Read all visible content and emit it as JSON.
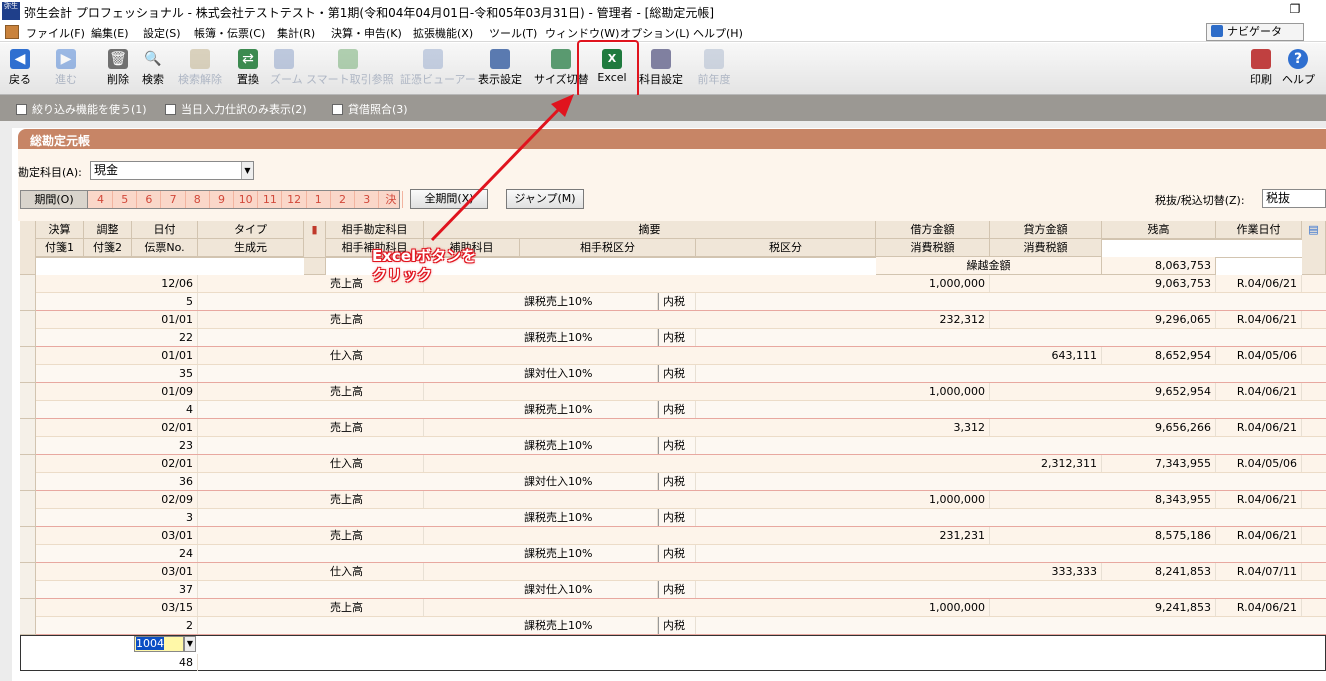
{
  "window": {
    "title": "弥生会計 プロフェッショナル - 株式会社テストテスト・第1期(令和04年04月01日-令和05年03月31日) - 管理者 - [総勘定元帳]",
    "app_icon_text": "弥生",
    "restore_symbol": "❐",
    "close_symbol": "✕"
  },
  "menu": {
    "items": [
      "ファイル(F)",
      "編集(E)",
      "設定(S)",
      "帳簿・伝票(C)",
      "集計(R)",
      "決算・申告(K)",
      "拡張機能(X)",
      "ツール(T)",
      "ウィンドウ(W)",
      "オプション(L)",
      "ヘルプ(H)"
    ],
    "navigator_label": "ナビゲータ"
  },
  "toolbar": {
    "back": "戻る",
    "forward": "進む",
    "delete": "削除",
    "search": "検索",
    "search_clear": "検索解除",
    "replace": "置換",
    "zoom": "ズーム",
    "smart_ref": "スマート取引参照",
    "voucher_viewer": "証憑ビューアー",
    "display_settings": "表示設定",
    "size_toggle": "サイズ切替",
    "excel": "Excel",
    "account_settings": "科目設定",
    "prev_year": "前年度",
    "print": "印刷",
    "help": "ヘルプ"
  },
  "options": {
    "filter": "絞り込み機能を使う(1)",
    "today_only": "当日入力仕訳のみ表示(2)",
    "reconcile": "貸借照合(3)"
  },
  "ledger": {
    "title": "総勘定元帳",
    "account_label": "勘定科目(A):",
    "account_value": "現金",
    "period_label": "期間(O)",
    "months": [
      "4",
      "5",
      "6",
      "7",
      "8",
      "9",
      "10",
      "11",
      "12",
      "1",
      "2",
      "3",
      "決"
    ],
    "all_period_button": "全期間(X)",
    "jump_button": "ジャンプ(M)",
    "tax_label": "税抜/税込切替(Z):",
    "tax_value": "税抜"
  },
  "columns": {
    "r1": [
      "決算",
      "調整",
      "日付",
      "タイプ",
      "",
      "相手勘定科目",
      "摘要",
      "借方金額",
      "貸方金額",
      "残高",
      "作業日付"
    ],
    "r2": [
      "付箋1",
      "付箋2",
      "伝票No.",
      "生成元",
      "",
      "相手補助科目",
      "補助科目",
      "相手税区分",
      "税区分",
      "消費税額",
      "消費税額"
    ],
    "carry_label": "繰越金額",
    "carry_value": "8,063,753"
  },
  "rows": [
    {
      "date": "12/06",
      "no": "5",
      "account": "売上高",
      "tax": "課税売上10%",
      "taxtype": "内税",
      "debit": "1,000,000",
      "credit": "",
      "balance": "9,063,753",
      "workdate": "R.04/06/21"
    },
    {
      "date": "01/01",
      "no": "22",
      "account": "売上高",
      "tax": "課税売上10%",
      "taxtype": "内税",
      "debit": "232,312",
      "credit": "",
      "balance": "9,296,065",
      "workdate": "R.04/06/21"
    },
    {
      "date": "01/01",
      "no": "35",
      "account": "仕入高",
      "tax": "課対仕入10%",
      "taxtype": "内税",
      "debit": "",
      "credit": "643,111",
      "balance": "8,652,954",
      "workdate": "R.04/05/06"
    },
    {
      "date": "01/09",
      "no": "4",
      "account": "売上高",
      "tax": "課税売上10%",
      "taxtype": "内税",
      "debit": "1,000,000",
      "credit": "",
      "balance": "9,652,954",
      "workdate": "R.04/06/21"
    },
    {
      "date": "02/01",
      "no": "23",
      "account": "売上高",
      "tax": "課税売上10%",
      "taxtype": "内税",
      "debit": "3,312",
      "credit": "",
      "balance": "9,656,266",
      "workdate": "R.04/06/21"
    },
    {
      "date": "02/01",
      "no": "36",
      "account": "仕入高",
      "tax": "課対仕入10%",
      "taxtype": "内税",
      "debit": "",
      "credit": "2,312,311",
      "balance": "7,343,955",
      "workdate": "R.04/05/06"
    },
    {
      "date": "02/09",
      "no": "3",
      "account": "売上高",
      "tax": "課税売上10%",
      "taxtype": "内税",
      "debit": "1,000,000",
      "credit": "",
      "balance": "8,343,955",
      "workdate": "R.04/06/21"
    },
    {
      "date": "03/01",
      "no": "24",
      "account": "売上高",
      "tax": "課税売上10%",
      "taxtype": "内税",
      "debit": "231,231",
      "credit": "",
      "balance": "8,575,186",
      "workdate": "R.04/06/21"
    },
    {
      "date": "03/01",
      "no": "37",
      "account": "仕入高",
      "tax": "課対仕入10%",
      "taxtype": "内税",
      "debit": "",
      "credit": "333,333",
      "balance": "8,241,853",
      "workdate": "R.04/07/11"
    },
    {
      "date": "03/15",
      "no": "2",
      "account": "売上高",
      "tax": "課税売上10%",
      "taxtype": "内税",
      "debit": "1,000,000",
      "credit": "",
      "balance": "9,241,853",
      "workdate": "R.04/06/21"
    }
  ],
  "edit_row": {
    "date": "1004",
    "no": "48"
  },
  "callout": {
    "line1": "Excelボタンを",
    "line2": "クリック",
    "color": "#e0141e"
  }
}
